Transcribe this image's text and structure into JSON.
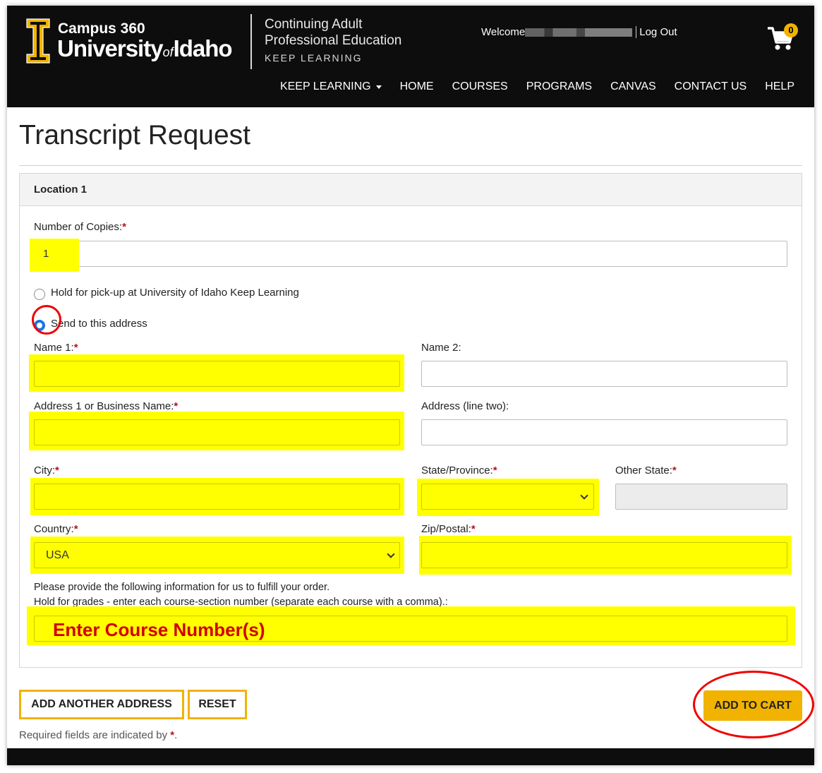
{
  "header": {
    "logo_line1": "Campus 360",
    "logo_university": "University",
    "logo_of": "of",
    "logo_idaho": "Idaho",
    "cape_line1": "Continuing Adult",
    "cape_line2": "Professional Education",
    "cape_line3": "KEEP LEARNING",
    "welcome": "Welcome",
    "logout": "Log Out",
    "cart_count": "0",
    "nav": [
      "KEEP LEARNING",
      "HOME",
      "COURSES",
      "PROGRAMS",
      "CANVAS",
      "CONTACT US",
      "HELP"
    ]
  },
  "page": {
    "title": "Transcript Request",
    "panel_title": "Location 1"
  },
  "form": {
    "copies_label": "Number of Copies:",
    "copies_value": "1",
    "option_pickup": "Hold for pick-up at University of Idaho Keep Learning",
    "option_send": "Send to this address",
    "name1_label": "Name 1:",
    "name2_label": "Name 2:",
    "address1_label": "Address 1 or Business Name:",
    "address2_label": "Address (line two):",
    "city_label": "City:",
    "state_label": "State/Province:",
    "other_state_label": "Other State:",
    "country_label": "Country:",
    "country_value": "USA",
    "zip_label": "Zip/Postal:",
    "info_line": "Please provide the following information for us to fulfill your order.",
    "grades_line": "Hold for grades - enter each course-section number (separate each course with a comma).:",
    "course_placeholder": "Enter Course Number(s)",
    "required_mark": "*"
  },
  "actions": {
    "add_address": "ADD ANOTHER ADDRESS",
    "reset": "RESET",
    "add_to_cart": "ADD TO CART",
    "footnote": "Required fields are indicated by"
  },
  "colors": {
    "brand_gold": "#f1b300",
    "header_black": "#0d0d0d",
    "highlight_yellow": "#ffff00",
    "annotation_red": "#e00000",
    "required_red": "#b5121b"
  }
}
